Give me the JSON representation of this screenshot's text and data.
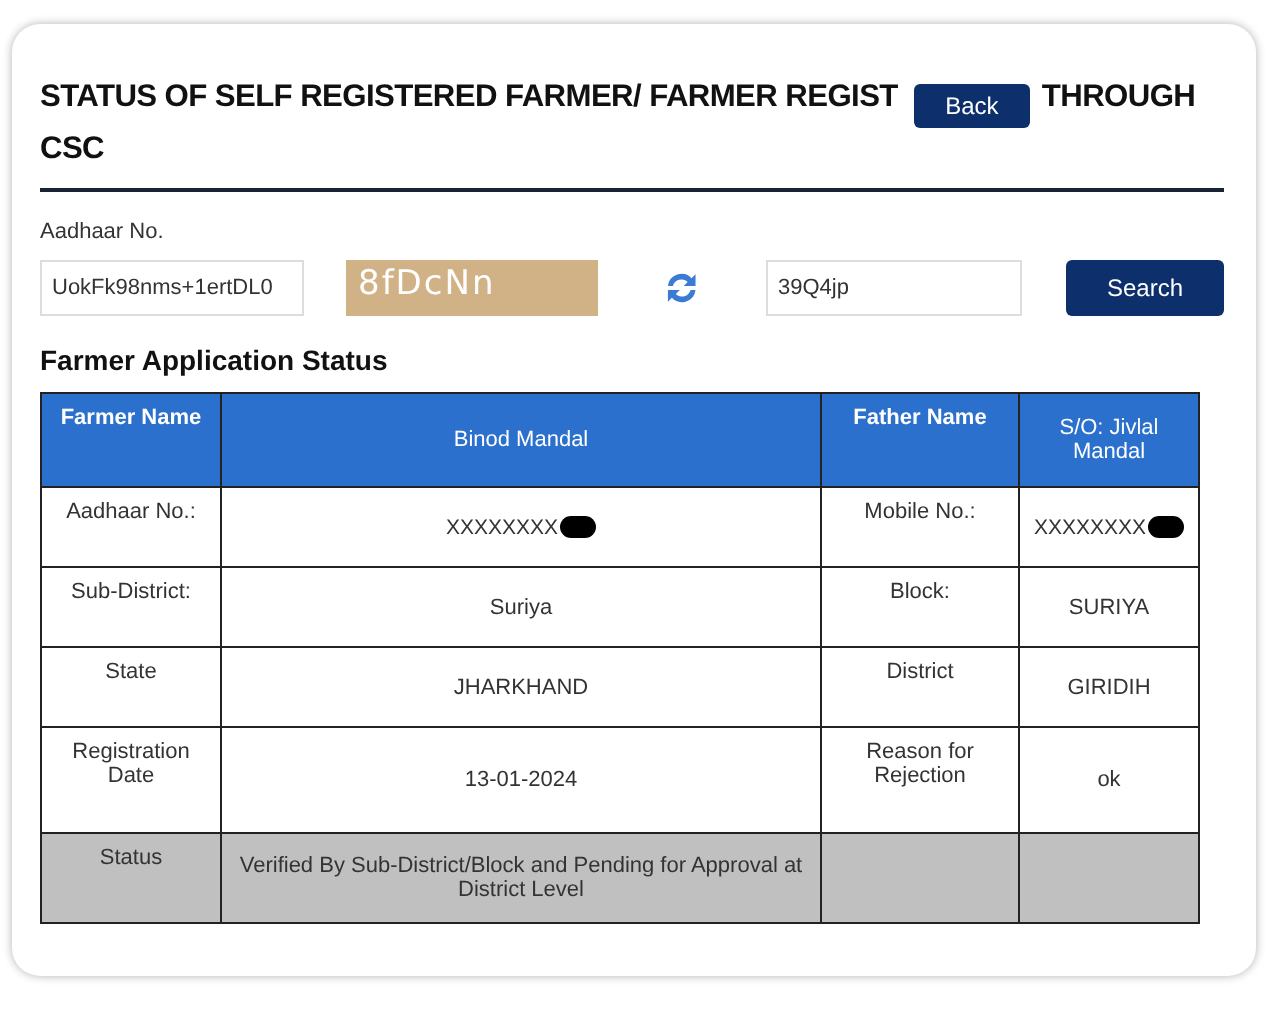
{
  "title": {
    "before": "STATUS OF SELF REGISTERED FARMER/ FARMER REGIST",
    "after_line1": "THROUGH",
    "line2": "CSC"
  },
  "back_button": "Back",
  "form": {
    "label": "Aadhaar No.",
    "aadhaar_value": "UokFk98nms+1ertDL0",
    "captcha": "8fDcNn",
    "captcha_value": "39Q4jp",
    "search_button": "Search"
  },
  "section_title": "Farmer Application Status",
  "table": {
    "rows": [
      {
        "kind": "header",
        "cells": [
          {
            "text": "Farmer Name"
          },
          {
            "text": "Binod Mandal"
          },
          {
            "text": "Father Name"
          },
          {
            "text": "S/O: Jivlal Mandal"
          }
        ]
      },
      {
        "kind": "data",
        "cells": [
          {
            "text": "Aadhaar No.:"
          },
          {
            "text": "XXXXXXXX",
            "redacted": true
          },
          {
            "text": "Mobile No.:"
          },
          {
            "text": "XXXXXXXX",
            "redacted": true
          }
        ]
      },
      {
        "kind": "data",
        "cells": [
          {
            "text": "Sub-District:"
          },
          {
            "text": "Suriya"
          },
          {
            "text": "Block:"
          },
          {
            "text": "SURIYA"
          }
        ]
      },
      {
        "kind": "data",
        "cells": [
          {
            "text": "State"
          },
          {
            "text": "JHARKHAND"
          },
          {
            "text": "District"
          },
          {
            "text": "GIRIDIH"
          }
        ]
      },
      {
        "kind": "data",
        "cells": [
          {
            "text": "Registration Date"
          },
          {
            "text": "13-01-2024"
          },
          {
            "text": "Reason for Rejection"
          },
          {
            "text": "ok"
          }
        ]
      },
      {
        "kind": "status",
        "cells": [
          {
            "text": "Status"
          },
          {
            "text": "Verified By Sub-District/Block and Pending for Approval at District Level"
          }
        ]
      }
    ]
  }
}
